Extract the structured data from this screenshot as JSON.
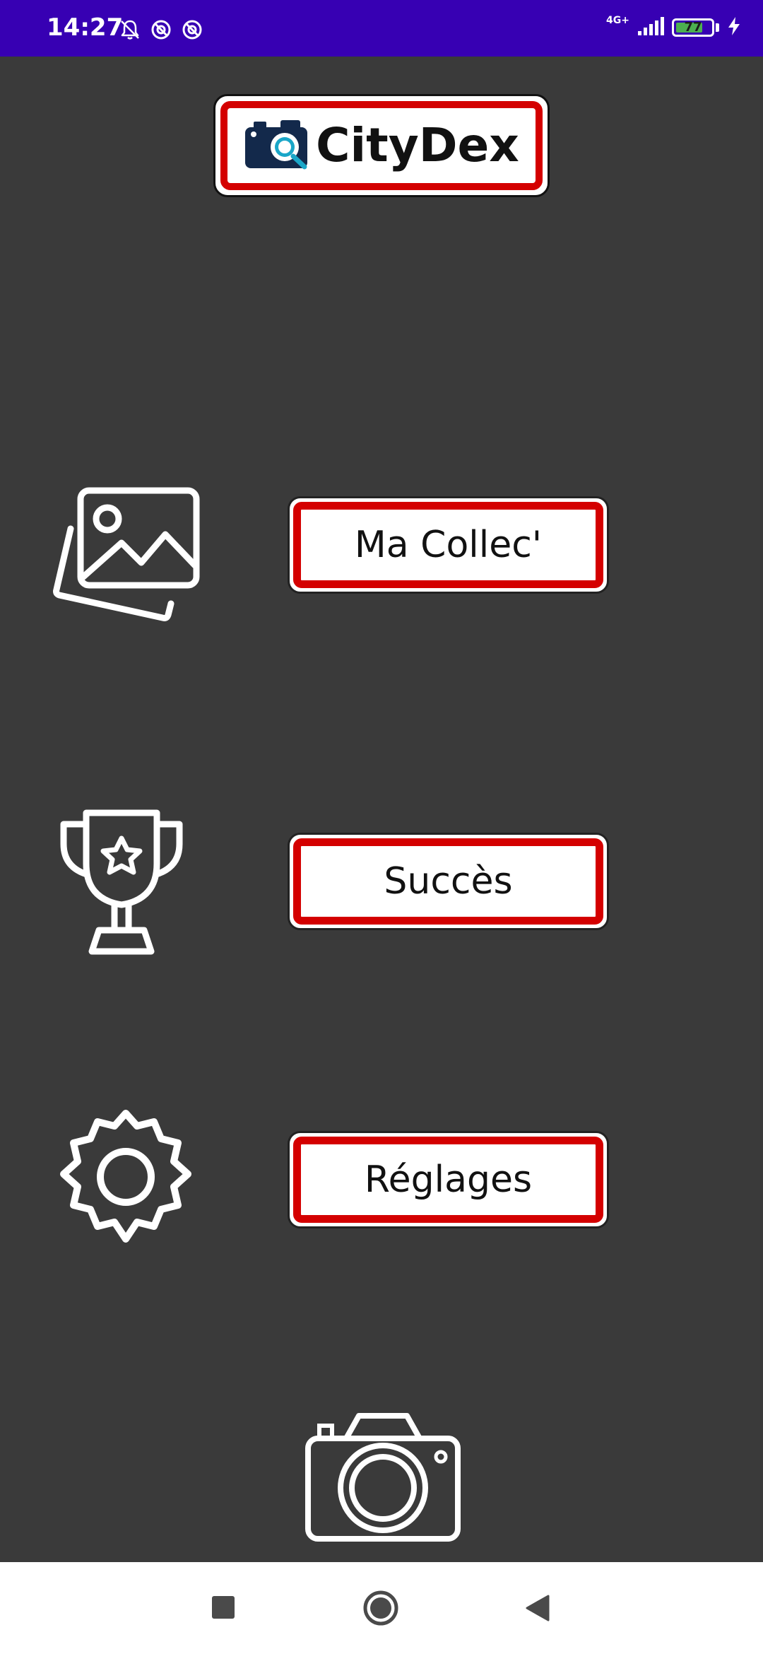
{
  "status_bar": {
    "time": "14:27",
    "network": "4G+",
    "battery": "77",
    "battery_level": 0.77,
    "icons_left": [
      "bell-off-icon",
      "do-not-disturb-icon",
      "do-not-disturb-icon"
    ],
    "icons_right": [
      "signal-icon",
      "battery-icon",
      "charging-icon"
    ]
  },
  "logo": {
    "text": "CityDex",
    "icon": "camera-magnifier-icon"
  },
  "menu": [
    {
      "label": "Ma Collec'",
      "icon": "gallery-icon"
    },
    {
      "label": "Succès",
      "icon": "trophy-icon"
    },
    {
      "label": "Réglages",
      "icon": "gear-icon"
    }
  ],
  "camera_button": {
    "icon": "camera-icon"
  },
  "nav_bar": {
    "icons": [
      "recent-apps-icon",
      "home-icon",
      "back-icon"
    ]
  },
  "colors": {
    "status_bar": "#3700b3",
    "background": "#3a3a3a",
    "accent_red": "#d40000",
    "button_fill": "#ffffff",
    "icon_white": "#ffffff",
    "battery_green": "#4caf50"
  }
}
